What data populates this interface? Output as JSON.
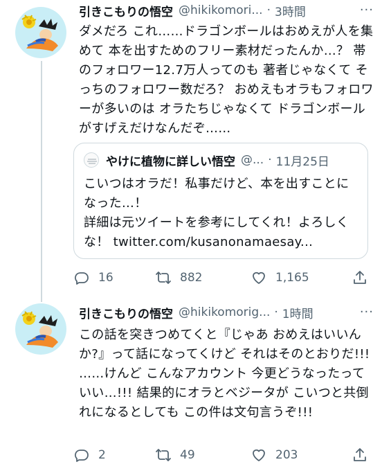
{
  "tweets": [
    {
      "name": "引きこもりの悟空",
      "handle": "@hikikomori...",
      "dot": "·",
      "time": "3時間",
      "more": "···",
      "text": "ダメだろ これ……ドラゴンボールはおめえが人を集めて 本を出すためのフリー素材だったんか…？ 帯のフォロワー12.7万人ってのも 著者じゃなくて そっちのフォロワー数だろ？ おめえもオラもフォロワーが多いのは オラたちじゃなくて ドラゴンボールがすげえだけなんだぞ……",
      "quote": {
        "name": "やけに植物に詳しい悟空",
        "handle": "@...",
        "dot": "·",
        "time": "11月25日",
        "text": "こいつはオラだ！私事だけど、本を出すことになった…！\n詳細は元ツイートを参考にしてくれ！よろしくな！ twitter.com/kusanonamaesay..."
      },
      "replies": "16",
      "retweets": "882",
      "likes": "1,165"
    },
    {
      "name": "引きこもりの悟空",
      "handle": "@hikikomorig...",
      "dot": "·",
      "time": "1時間",
      "more": "···",
      "text": "この話を突きつめてくと『じゃあ おめえはいいんか?』って話になってくけど それはそのとおりだ!!! ……けんど こんなアカウント 今更どうなったっていい…!!! 結果的にオラとベジータが こいつと共倒れになるとしても この件は文句言うぞ!!!",
      "replies": "2",
      "retweets": "49",
      "likes": "203"
    }
  ],
  "icons": {
    "reply": "reply-icon",
    "retweet": "retweet-icon",
    "like": "heart-icon",
    "share": "share-icon",
    "more": "more-icon"
  },
  "colors": {
    "text": "#0f1419",
    "secondary": "#536471",
    "border": "#cfd9de",
    "avatar_bg": "#c9eef6"
  }
}
